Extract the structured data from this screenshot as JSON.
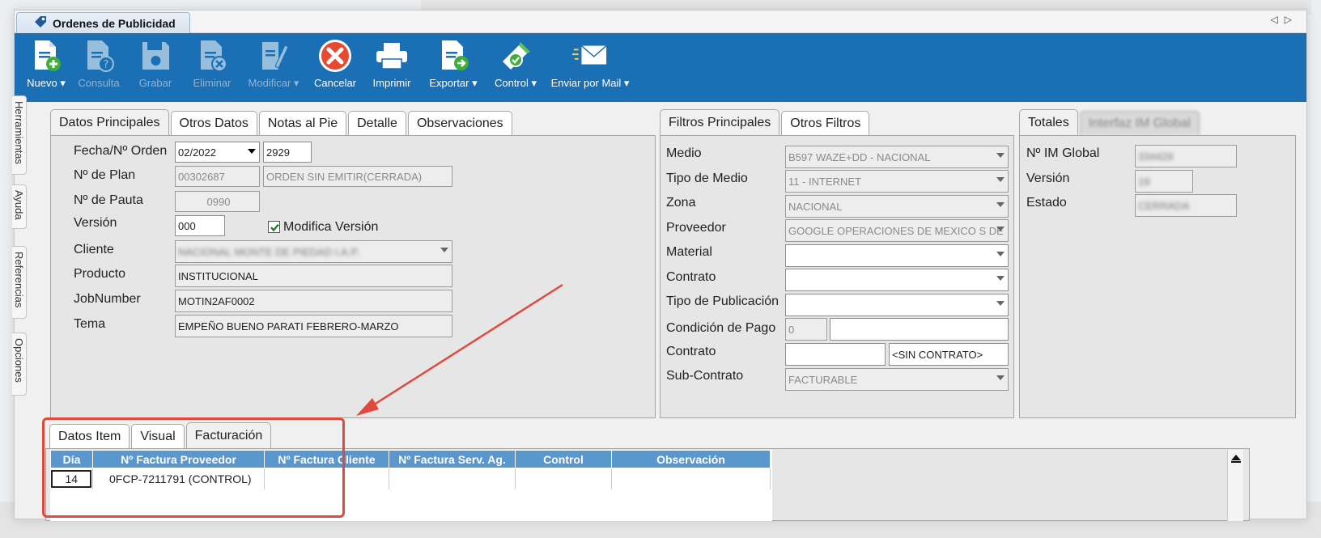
{
  "window": {
    "title": "Ordenes de Publicidad"
  },
  "toolbar": [
    {
      "label": "Nuevo",
      "dropdown": true,
      "enabled": true,
      "icon": "new-doc-icon"
    },
    {
      "label": "Consulta",
      "dropdown": false,
      "enabled": false,
      "icon": "query-icon"
    },
    {
      "label": "Grabar",
      "dropdown": false,
      "enabled": false,
      "icon": "save-icon"
    },
    {
      "label": "Eliminar",
      "dropdown": false,
      "enabled": false,
      "icon": "delete-icon"
    },
    {
      "label": "Modificar",
      "dropdown": true,
      "enabled": false,
      "icon": "edit-icon"
    },
    {
      "label": "Cancelar",
      "dropdown": false,
      "enabled": true,
      "icon": "cancel-icon"
    },
    {
      "label": "Imprimir",
      "dropdown": false,
      "enabled": true,
      "icon": "printer-icon"
    },
    {
      "label": "Exportar",
      "dropdown": true,
      "enabled": true,
      "icon": "export-icon"
    },
    {
      "label": "Control",
      "dropdown": true,
      "enabled": true,
      "icon": "control-icon"
    },
    {
      "label": "Enviar por Mail",
      "dropdown": true,
      "enabled": true,
      "icon": "mail-icon"
    }
  ],
  "side_tabs": [
    "Herramientas",
    "Ayuda",
    "Referencias",
    "Opciones"
  ],
  "main_tabs": [
    "Datos Principales",
    "Otros Datos",
    "Notas al Pie",
    "Detalle",
    "Observaciones"
  ],
  "main": {
    "fecha_label": "Fecha/Nº Orden",
    "fecha_value": "02/2022",
    "orden_value": "2929",
    "plan_label": "Nº de Plan",
    "plan_value": "00302687",
    "plan_status": "ORDEN SIN EMITIR(CERRADA)",
    "pauta_label": "Nº de Pauta",
    "pauta_value": "0990",
    "version_label": "Versión",
    "version_value": "000",
    "modifica_label": "Modifica Versión",
    "modifica_checked": true,
    "cliente_label": "Cliente",
    "cliente_value": "NACIONAL MONTE DE PIEDAD I.A.P.",
    "producto_label": "Producto",
    "producto_value": "INSTITUCIONAL",
    "job_label": "JobNumber",
    "job_value": "MOTIN2AF0002",
    "tema_label": "Tema",
    "tema_value": "EMPEÑO BUENO PARATI  FEBRERO-MARZO"
  },
  "filter_tabs": [
    "Filtros Principales",
    "Otros Filtros"
  ],
  "filters": {
    "medio_label": "Medio",
    "medio_value": "B597 WAZE+DD - NACIONAL",
    "tipo_medio_label": "Tipo de Medio",
    "tipo_medio_value": "11 - INTERNET",
    "zona_label": "Zona",
    "zona_value": "NACIONAL",
    "proveedor_label": "Proveedor",
    "proveedor_value": "GOOGLE OPERACIONES DE MEXICO S DE",
    "material_label": "Material",
    "material_value": "",
    "contrato_label": "Contrato",
    "contrato_value": "",
    "tipo_pub_label": "Tipo de Publicación",
    "tipo_pub_value": "",
    "cond_pago_label": "Condición de Pago",
    "cond_pago_value": "0",
    "cond_pago_desc": "",
    "contrato2_label": "Contrato",
    "contrato2_value": "",
    "contrato2_desc": "<SIN CONTRATO>",
    "subcontrato_label": "Sub-Contrato",
    "subcontrato_value": "FACTURABLE"
  },
  "totals_tabs": [
    "Totales",
    "Interfaz IM Global"
  ],
  "totals": {
    "im_label": "Nº IM Global",
    "im_value": "334429",
    "version_label": "Versión",
    "version_value": "19",
    "estado_label": "Estado",
    "estado_value": "CERRADA"
  },
  "bottom_tabs": [
    "Datos Item",
    "Visual",
    "Facturación"
  ],
  "invoice_grid": {
    "columns": [
      "Día",
      "Nº Factura Proveedor",
      "Nº Factura Cliente",
      "Nº Factura Serv. Ag.",
      "Control",
      "Observación"
    ],
    "rows": [
      [
        "14",
        "0FCP-7211791 (CONTROL)",
        "",
        "",
        "",
        ""
      ]
    ]
  },
  "colors": {
    "toolbar": "#1a6fb5",
    "grid_header": "#5b97cf",
    "annotation": "#e0493b"
  }
}
